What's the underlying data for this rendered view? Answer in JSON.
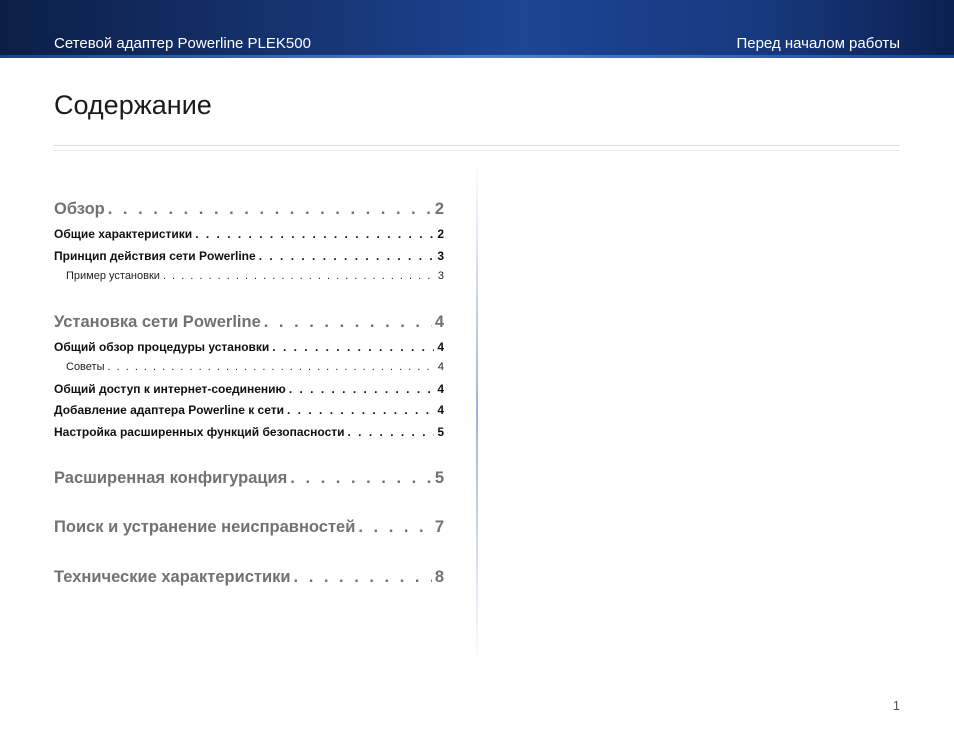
{
  "header": {
    "left": "Сетевой адаптер Powerline PLEK500",
    "right": "Перед началом работы"
  },
  "title": "Содержание",
  "toc": [
    {
      "label": "Обзор",
      "page": "2"
    },
    {
      "label": "Общие характеристики",
      "page": "2"
    },
    {
      "label": "Принцип действия сети Powerline",
      "page": "3"
    },
    {
      "label": "Пример установки",
      "page": "3"
    },
    {
      "label": "Установка сети Powerline",
      "page": "4"
    },
    {
      "label": "Общий обзор процедуры установки",
      "page": "4"
    },
    {
      "label": "Советы",
      "page": "4"
    },
    {
      "label": "Общий доступ к интернет-соединению",
      "page": "4"
    },
    {
      "label": "Добавление адаптера Powerline к сети",
      "page": "4"
    },
    {
      "label": "Настройка расширенных функций безопасности",
      "page": "5"
    },
    {
      "label": "Расширенная конфигурация",
      "page": "5"
    },
    {
      "label": "Поиск и устранение неисправностей",
      "page": "7"
    },
    {
      "label": "Технические характеристики",
      "page": "8"
    }
  ],
  "page_number": "1"
}
